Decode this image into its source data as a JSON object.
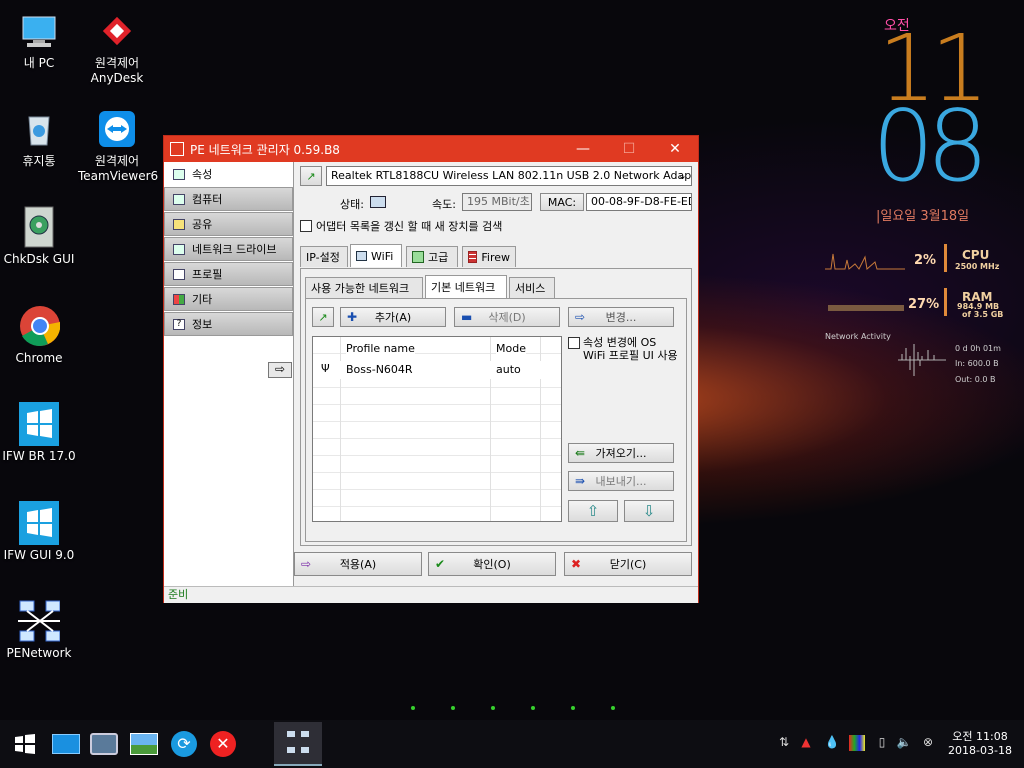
{
  "desktop": {
    "icons": [
      {
        "label": "내 PC",
        "icon": "computer-icon"
      },
      {
        "label": "원격제어\nAnyDesk",
        "icon": "anydesk-icon"
      },
      {
        "label": "휴지통",
        "icon": "recycle-bin-icon"
      },
      {
        "label": "원격제어\nTeamViewer6",
        "icon": "teamviewer-icon"
      },
      {
        "label": "ChkDsk GUI",
        "icon": "chkdsk-icon"
      },
      {
        "label": "Chrome",
        "icon": "chrome-icon"
      },
      {
        "label": "IFW BR 17.0",
        "icon": "windows-icon"
      },
      {
        "label": "IFW GUI 9.0",
        "icon": "windows-icon"
      },
      {
        "label": "PENetwork",
        "icon": "network-icon"
      }
    ]
  },
  "window": {
    "title": "PE 네트워크 관리자 0.59.B8",
    "minimize": "—",
    "maximize": "☐",
    "close": "✕",
    "sidebar": [
      {
        "label": "속성",
        "active": true
      },
      {
        "label": "컴퓨터"
      },
      {
        "label": "공유"
      },
      {
        "label": "네트워크 드라이브"
      },
      {
        "label": "프로필"
      },
      {
        "label": "기타"
      },
      {
        "label": "정보"
      }
    ],
    "adapter": "Realtek RTL8188CU Wireless LAN 802.11n USB 2.0 Network Adapte",
    "status_label": "상태:",
    "speed_label": "속도:",
    "speed_value": "195 MBit/초",
    "mac_label": "MAC:",
    "mac_value": "00-08-9F-D8-FE-ED",
    "refresh_checkbox": "어댑터 목록을 갱신 할 때 새 장치를 검색",
    "tabs": [
      "IP-설정",
      "WiFi",
      "고급",
      "Firew"
    ],
    "subtabs": [
      "사용 가능한 네트워크",
      "기본 네트워크",
      "서비스"
    ],
    "buttons": {
      "add": "추가(A)",
      "delete": "삭제(D)",
      "change": "변경...",
      "import": "가져오기...",
      "export": "내보내기..."
    },
    "list_headers": [
      "Profile name",
      "Mode"
    ],
    "list_rows": [
      {
        "name": "Boss-N604R",
        "mode": "auto"
      }
    ],
    "os_checkbox": "속성 변경에 OS WiFi 프로필 UI 사용",
    "apply": "적용(A)",
    "ok": "확인(O)",
    "cancel": "닫기(C)",
    "status": "준비"
  },
  "widget": {
    "ampm": "오전",
    "hour": "11",
    "minute": "08",
    "date": "|일요일 3월18일",
    "cpu_pct": "2%",
    "cpu_label": "CPU",
    "cpu_freq": "2500 MHz",
    "ram_pct": "27%",
    "ram_label": "RAM",
    "ram_used": "984.9 MB",
    "ram_total": "of  3.5 GB",
    "net_title": "Network Activity",
    "net_uptime": "0 d 0h 01m",
    "net_in": "In: 600.0 B",
    "net_out": "Out: 0.0 B"
  },
  "taskbar": {
    "time": "오전 11:08",
    "date": "2018-03-18"
  }
}
